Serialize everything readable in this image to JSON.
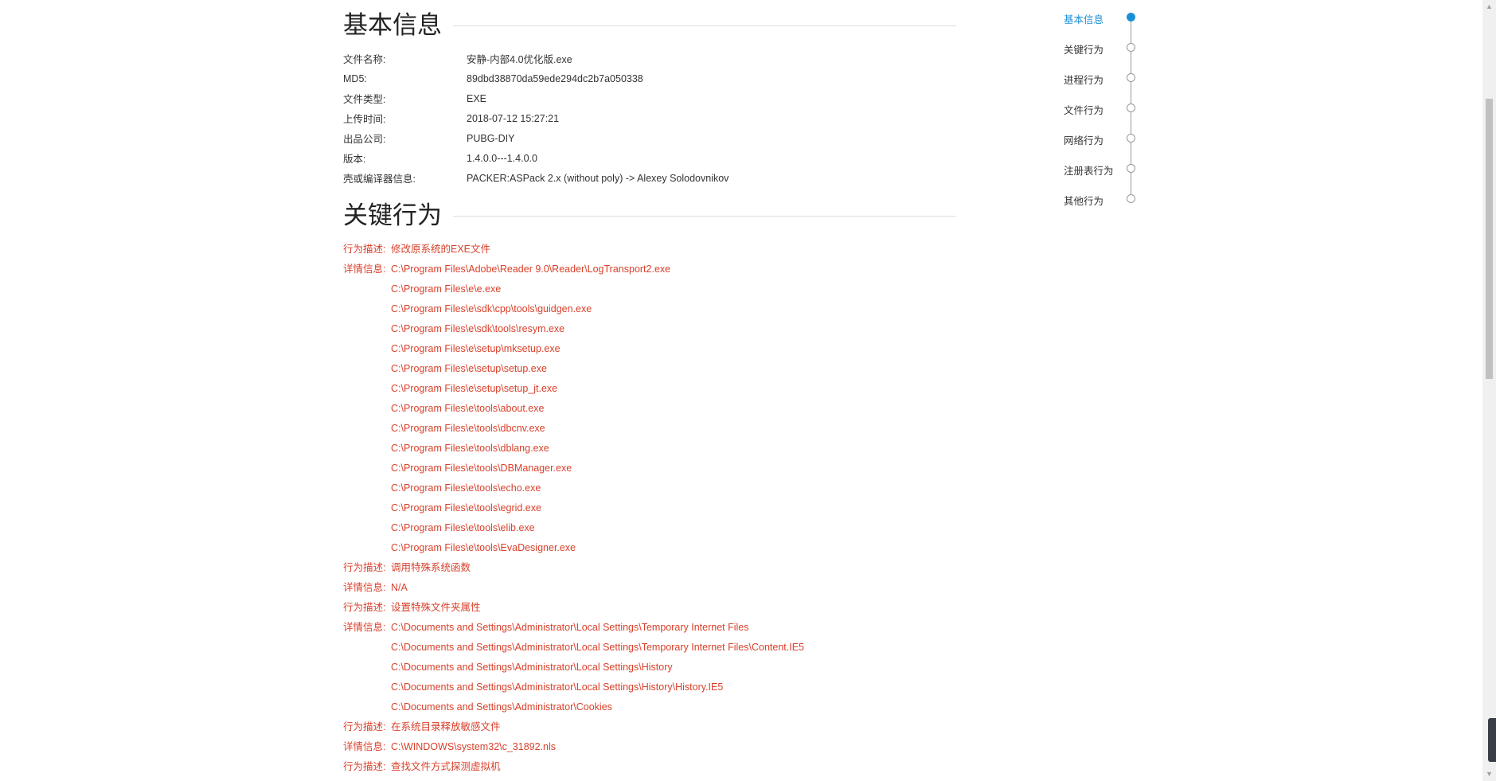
{
  "basic": {
    "title": "基本信息",
    "rows": [
      {
        "k": "文件名称:",
        "v": "安静-内部4.0优化版.exe"
      },
      {
        "k": "MD5:",
        "v": "89dbd38870da59ede294dc2b7a050338"
      },
      {
        "k": "文件类型:",
        "v": "EXE"
      },
      {
        "k": "上传时间:",
        "v": "2018-07-12 15:27:21"
      },
      {
        "k": "出品公司:",
        "v": "PUBG-DIY"
      },
      {
        "k": "版本:",
        "v": "1.4.0.0---1.4.0.0"
      },
      {
        "k": "壳或编译器信息:",
        "v": "PACKER:ASPack 2.x (without poly) -> Alexey Solodovnikov"
      }
    ]
  },
  "key": {
    "title": "关键行为",
    "groups": [
      {
        "desc_label": "行为描述:",
        "desc": "修改原系统的EXE文件",
        "detail_label": "详情信息:",
        "details": [
          "C:\\Program Files\\Adobe\\Reader 9.0\\Reader\\LogTransport2.exe",
          "C:\\Program Files\\e\\e.exe",
          "C:\\Program Files\\e\\sdk\\cpp\\tools\\guidgen.exe",
          "C:\\Program Files\\e\\sdk\\tools\\resym.exe",
          "C:\\Program Files\\e\\setup\\mksetup.exe",
          "C:\\Program Files\\e\\setup\\setup.exe",
          "C:\\Program Files\\e\\setup\\setup_jt.exe",
          "C:\\Program Files\\e\\tools\\about.exe",
          "C:\\Program Files\\e\\tools\\dbcnv.exe",
          "C:\\Program Files\\e\\tools\\dblang.exe",
          "C:\\Program Files\\e\\tools\\DBManager.exe",
          "C:\\Program Files\\e\\tools\\echo.exe",
          "C:\\Program Files\\e\\tools\\egrid.exe",
          "C:\\Program Files\\e\\tools\\elib.exe",
          "C:\\Program Files\\e\\tools\\EvaDesigner.exe"
        ]
      },
      {
        "desc_label": "行为描述:",
        "desc": "调用特殊系统函数",
        "detail_label": "详情信息:",
        "details": [
          "N/A"
        ]
      },
      {
        "desc_label": "行为描述:",
        "desc": "设置特殊文件夹属性",
        "detail_label": "详情信息:",
        "details": [
          "C:\\Documents and Settings\\Administrator\\Local Settings\\Temporary Internet Files",
          "C:\\Documents and Settings\\Administrator\\Local Settings\\Temporary Internet Files\\Content.IE5",
          "C:\\Documents and Settings\\Administrator\\Local Settings\\History",
          "C:\\Documents and Settings\\Administrator\\Local Settings\\History\\History.IE5",
          "C:\\Documents and Settings\\Administrator\\Cookies"
        ]
      },
      {
        "desc_label": "行为描述:",
        "desc": "在系统目录释放敏感文件",
        "detail_label": "详情信息:",
        "details": [
          "C:\\WINDOWS\\system32\\c_31892.nls"
        ]
      },
      {
        "desc_label": "行为描述:",
        "desc": "查找文件方式探测虚拟机",
        "detail_label": "",
        "details": []
      }
    ]
  },
  "nav": {
    "active_index": 0,
    "items": [
      "基本信息",
      "关键行为",
      "进程行为",
      "文件行为",
      "网络行为",
      "注册表行为",
      "其他行为"
    ]
  },
  "colors": {
    "accent": "#1b8fd6",
    "behavior_text": "#d9412b"
  },
  "icons": {
    "scroll_up": "triangle-up",
    "scroll_down": "triangle-down"
  }
}
